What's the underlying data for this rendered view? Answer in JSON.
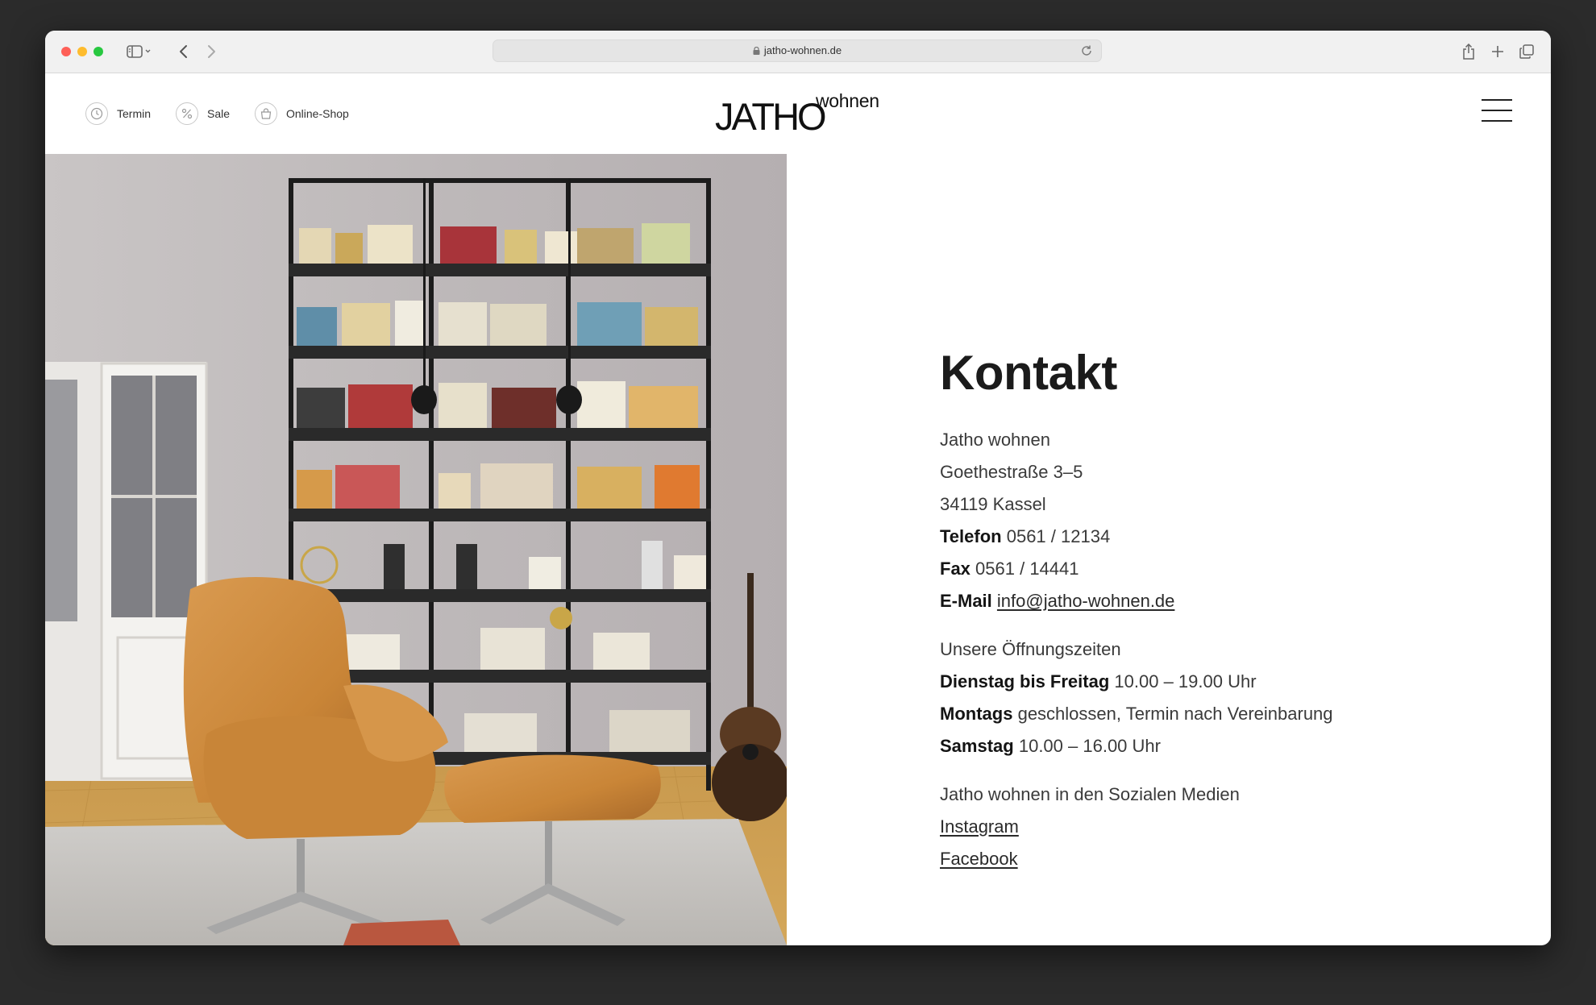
{
  "browser": {
    "url": "jatho-wohnen.de"
  },
  "nav": {
    "items": [
      {
        "label": "Termin",
        "icon": "clock-icon"
      },
      {
        "label": "Sale",
        "icon": "percent-icon"
      },
      {
        "label": "Online-Shop",
        "icon": "shopping-bag-icon"
      }
    ]
  },
  "logo": {
    "main": "JATHO",
    "sub": "wohnen"
  },
  "photo": {
    "description": ""
  },
  "contact": {
    "title": "Kontakt",
    "company": "Jatho wohnen",
    "street": "Goethestraße 3–5",
    "city": "34119 Kassel",
    "phone_label": "Telefon",
    "phone": "0561 / 12134",
    "fax_label": "Fax",
    "fax": "0561 / 14441",
    "email_label": "E-Mail",
    "email": "info@jatho-wohnen.de",
    "hours_heading": "Unsere Öffnungszeiten",
    "hours": [
      {
        "day": "Dienstag bis Freitag",
        "time": "10.00 – 19.00 Uhr"
      },
      {
        "day": "Montags",
        "time": "geschlossen, Termin nach Vereinbarung"
      },
      {
        "day": "Samstag",
        "time": "10.00 – 16.00 Uhr"
      }
    ],
    "social_heading": "Jatho wohnen in den Sozialen Medien",
    "instagram": "Instagram",
    "facebook": "Facebook"
  }
}
